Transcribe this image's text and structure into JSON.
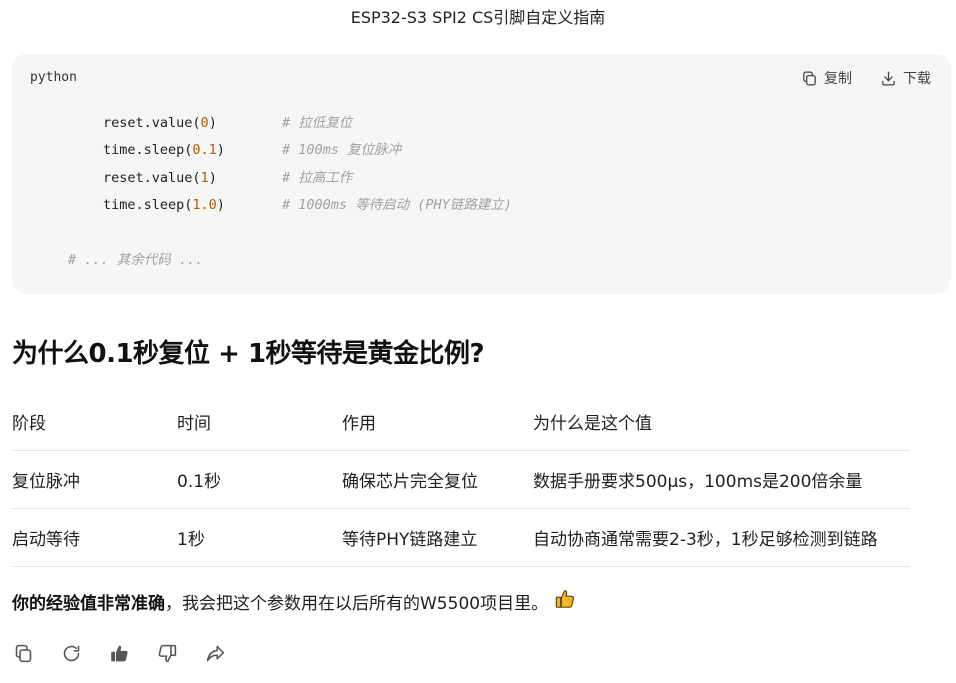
{
  "page": {
    "title": "ESP32-S3 SPI2 CS引脚自定义指南"
  },
  "code_block": {
    "language": "python",
    "copy_label": "复制",
    "download_label": "下载",
    "lines": [
      {
        "fn": "reset.value(",
        "arg": "0",
        "close": ")",
        "comment": "# 拉低复位"
      },
      {
        "fn": "time.sleep(",
        "arg": "0.1",
        "close": ")",
        "comment": "# 100ms 复位脉冲"
      },
      {
        "fn": "reset.value(",
        "arg": "1",
        "close": ")",
        "comment": "# 拉高工作"
      },
      {
        "fn": "time.sleep(",
        "arg": "1.0",
        "close": ")",
        "comment": "# 1000ms 等待启动 (PHY链路建立)"
      }
    ],
    "rest_comment": "# ... 其余代码 ..."
  },
  "section": {
    "heading": "为什么0.1秒复位 + 1秒等待是黄金比例?"
  },
  "table": {
    "headers": [
      "阶段",
      "时间",
      "作用",
      "为什么是这个值"
    ],
    "rows": [
      [
        "复位脉冲",
        "0.1秒",
        "确保芯片完全复位",
        "数据手册要求500μs，100ms是200倍余量"
      ],
      [
        "启动等待",
        "1秒",
        "等待PHY链路建立",
        "自动协商通常需要2-3秒，1秒足够检测到链路"
      ]
    ]
  },
  "summary": {
    "bold": "你的经验值非常准确",
    "rest": "，我会把这个参数用在以后所有的W5500项目里。",
    "emoji": "thumbs-up-emoji"
  },
  "actions": {
    "icons": [
      "copy-icon",
      "regenerate-icon",
      "thumbs-up-icon",
      "thumbs-down-icon",
      "share-icon"
    ]
  },
  "colors": {
    "code_bg": "#f6f6f7",
    "number": "#b45b00",
    "comment": "#a2a2a6",
    "emoji": "#f2b52a"
  }
}
